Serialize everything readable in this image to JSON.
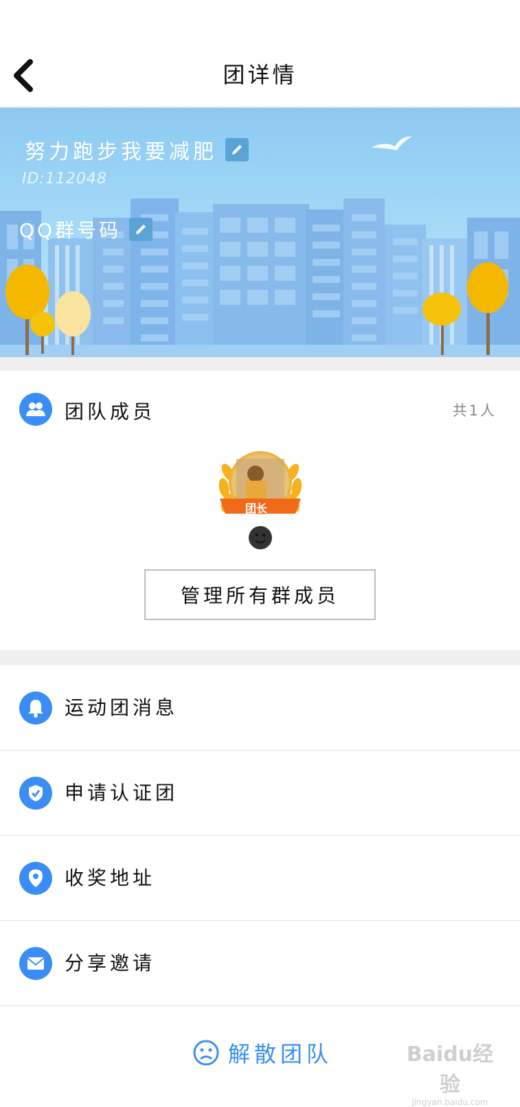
{
  "header": {
    "title": "团详情"
  },
  "banner": {
    "team_name": "努力跑步我要减肥",
    "team_id": "ID:112048",
    "qq_label": "QQ群号码"
  },
  "members": {
    "label": "团队成员",
    "count": "共1人",
    "leader_badge": "团长",
    "manage_button": "管理所有群成员"
  },
  "menu": [
    {
      "label": "运动团消息",
      "icon": "bell-icon"
    },
    {
      "label": "申请认证团",
      "icon": "shield-check-icon"
    },
    {
      "label": "收奖地址",
      "icon": "location-pin-icon"
    },
    {
      "label": "分享邀请",
      "icon": "envelope-icon"
    }
  ],
  "footer": {
    "dissolve_label": "解散团队"
  },
  "watermark": {
    "text": "Baidu经验",
    "url_text": "jingyan.baidu.com"
  },
  "colors": {
    "accent": "#3a8df4",
    "banner_sky": "#8cc9f2",
    "tree": "#f5b800"
  }
}
